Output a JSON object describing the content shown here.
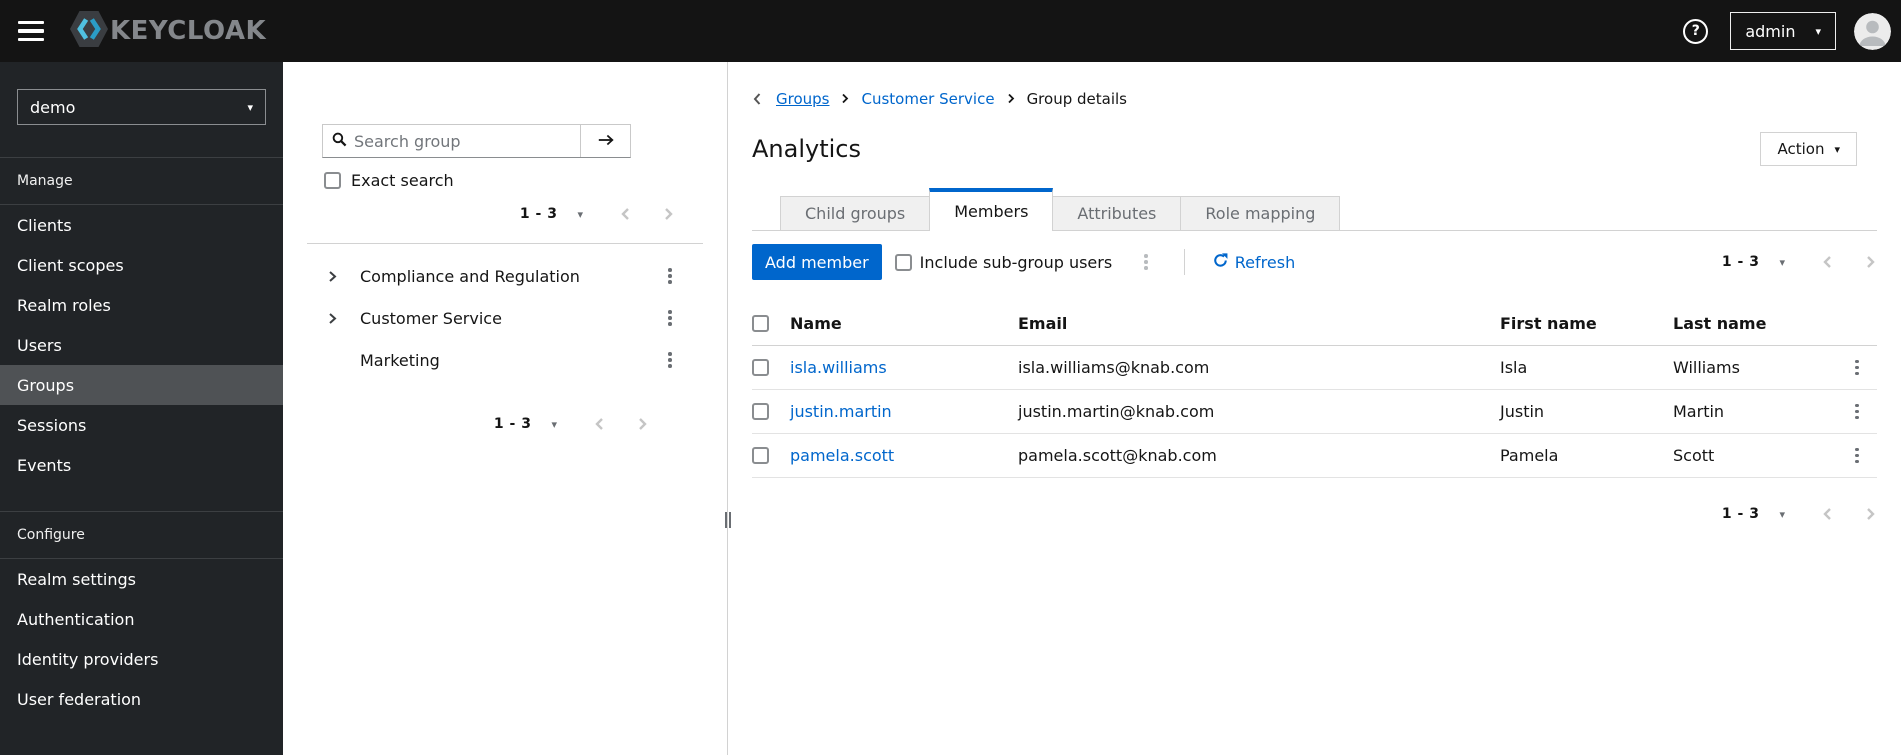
{
  "icons": {
    "caret_down": "▾",
    "help": "?"
  },
  "colors": {
    "accent": "#0066cc",
    "link": "#0066cc",
    "topbar_bg": "#141414",
    "sidebar_bg": "#212427",
    "sidebar_selected_bg": "#4f5255",
    "tab_inactive_bg": "#f0f0f0",
    "border": "#d2d2d2",
    "logo_blue_light": "#50c1e0",
    "logo_blue_dark": "#2b9dc6"
  },
  "topbar": {
    "brand": "KEYCLOAK",
    "username": "admin"
  },
  "sidebar": {
    "realm": "demo",
    "manage": {
      "label": "Manage",
      "items": [
        "Clients",
        "Client scopes",
        "Realm roles",
        "Users",
        "Groups",
        "Sessions",
        "Events"
      ],
      "selected": "Groups"
    },
    "configure": {
      "label": "Configure",
      "items": [
        "Realm settings",
        "Authentication",
        "Identity providers",
        "User federation"
      ]
    }
  },
  "tree": {
    "search_placeholder": "Search group",
    "exact_search_label": "Exact search",
    "pagination_top": {
      "range": "1 - 3"
    },
    "items": [
      {
        "name": "Compliance and Regulation",
        "expandable": true
      },
      {
        "name": "Customer Service",
        "expandable": true
      },
      {
        "name": "Marketing",
        "expandable": false
      }
    ],
    "pagination_bottom": {
      "range": "1 - 3"
    }
  },
  "main": {
    "breadcrumb": {
      "items": [
        {
          "label": "Groups"
        },
        {
          "label": "Customer Service"
        },
        {
          "label": "Group details"
        }
      ]
    },
    "title": "Analytics",
    "action_label": "Action",
    "tabs": [
      {
        "label": "Child groups",
        "active": false
      },
      {
        "label": "Members",
        "active": true
      },
      {
        "label": "Attributes",
        "active": false
      },
      {
        "label": "Role mapping",
        "active": false
      }
    ],
    "toolbar": {
      "add_member_label": "Add member",
      "include_subgroups_label": "Include sub-group users",
      "refresh_label": "Refresh",
      "pagination": {
        "range": "1 - 3"
      }
    },
    "table": {
      "headers": [
        "Name",
        "Email",
        "First name",
        "Last name"
      ],
      "rows": [
        {
          "username": "isla.williams",
          "email": "isla.williams@knab.com",
          "first_name": "Isla",
          "last_name": "Williams"
        },
        {
          "username": "justin.martin",
          "email": "justin.martin@knab.com",
          "first_name": "Justin",
          "last_name": "Martin"
        },
        {
          "username": "pamela.scott",
          "email": "pamela.scott@knab.com",
          "first_name": "Pamela",
          "last_name": "Scott"
        }
      ]
    },
    "pagination": {
      "range": "1 - 3"
    }
  }
}
